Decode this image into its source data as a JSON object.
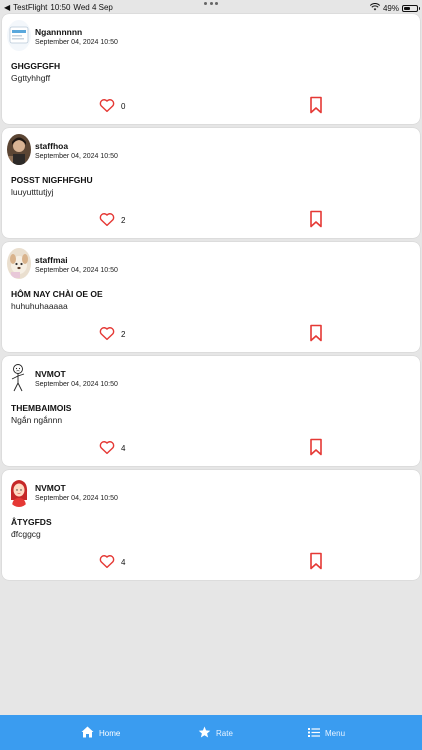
{
  "status_bar": {
    "back_app": "TestFlight",
    "time": "10:50",
    "date": "Wed 4 Sep",
    "battery": "49%",
    "battery_level": 0.49
  },
  "posts": [
    {
      "author": "Ngannnnnn",
      "timestamp": "September 04, 2024 10:50",
      "title": "GHGGFGFH",
      "body": "Ggttyhhgff",
      "likes": "0",
      "avatar_icon": "box-photo-avatar"
    },
    {
      "author": "staffhoa",
      "timestamp": "September 04, 2024 10:50",
      "title": "POSST NIGFHFGHU",
      "body": "luuyutttutjyj",
      "likes": "2",
      "avatar_icon": "person-photo-avatar"
    },
    {
      "author": "staffmai",
      "timestamp": "September 04, 2024 10:50",
      "title": "HÔM NAY CHÀI OE OE",
      "body": "huhuhuhaaaaa",
      "likes": "2",
      "avatar_icon": "dog-photo-avatar"
    },
    {
      "author": "NVMOT",
      "timestamp": "September 04, 2024 10:50",
      "title": "THEMBAIMOIS",
      "body": "Ngắn ngắnnn",
      "likes": "4",
      "avatar_icon": "stick-figure-avatar"
    },
    {
      "author": "NVMOT",
      "timestamp": "September 04, 2024 10:50",
      "title": "ÂTYGFDS",
      "body": "đfcggcg",
      "likes": "4",
      "avatar_icon": "woman-illustration-avatar"
    }
  ],
  "tab_bar": {
    "home_label": "Home",
    "rate_label": "Rate",
    "menu_label": "Menu",
    "background_color": "#3a9cf0",
    "accent_color": "#e53935"
  }
}
